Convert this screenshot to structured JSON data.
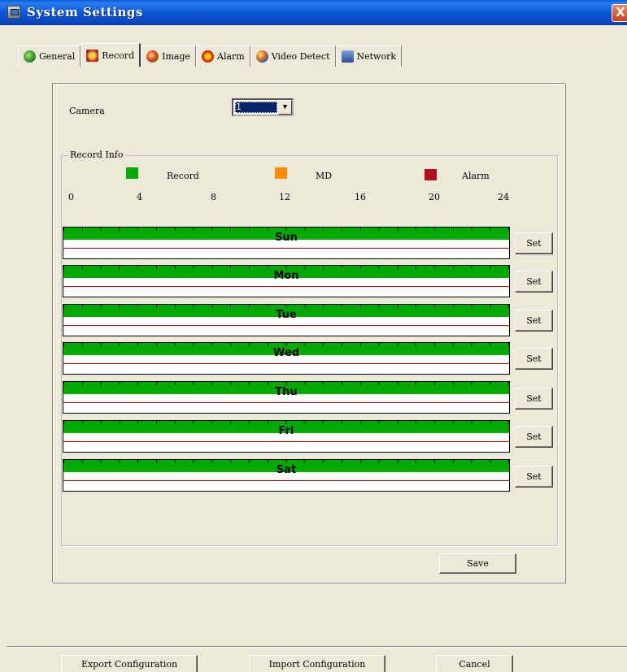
{
  "window": {
    "title": "System Settings",
    "close_label": "X"
  },
  "tabs": [
    {
      "label": "General",
      "icon": "general-icon",
      "active": false
    },
    {
      "label": "Record",
      "icon": "record-icon",
      "active": true
    },
    {
      "label": "Image",
      "icon": "image-icon",
      "active": false
    },
    {
      "label": "Alarm",
      "icon": "alarm-icon",
      "active": false
    },
    {
      "label": "Video Detect",
      "icon": "video-detect-icon",
      "active": false
    },
    {
      "label": "Network",
      "icon": "network-icon",
      "active": false
    }
  ],
  "camera": {
    "label": "Camera",
    "selected": "1"
  },
  "record_info": {
    "title": "Record Info",
    "legend": [
      {
        "label": "Record",
        "color": "#00aa00"
      },
      {
        "label": "MD",
        "color": "#ff8c00"
      },
      {
        "label": "Alarm",
        "color": "#b01020"
      }
    ],
    "ticks": [
      "0",
      "4",
      "8",
      "12",
      "16",
      "20",
      "24"
    ],
    "days": [
      {
        "name": "Sun",
        "record_fraction": 1.0
      },
      {
        "name": "Mon",
        "record_fraction": 1.0
      },
      {
        "name": "Tue",
        "record_fraction": 1.0
      },
      {
        "name": "Wed",
        "record_fraction": 1.0
      },
      {
        "name": "Thu",
        "record_fraction": 1.0
      },
      {
        "name": "Fri",
        "record_fraction": 1.0
      },
      {
        "name": "Sat",
        "record_fraction": 1.0
      }
    ],
    "set_label": "Set"
  },
  "buttons": {
    "save": "Save",
    "export": "Export Configuration",
    "import": "Import Configuration",
    "cancel": "Cancel"
  }
}
